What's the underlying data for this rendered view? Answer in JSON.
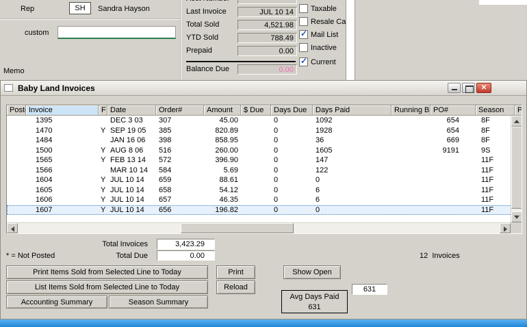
{
  "form": {
    "rep": {
      "label": "Rep",
      "code": "SH",
      "name": "Sandra Hayson"
    },
    "custom": {
      "label": "custom",
      "value": ""
    },
    "memo_label": "Memo",
    "balance_due_color": "#ee6fae",
    "fields": [
      {
        "label": "Acct Number",
        "value": "",
        "pink": false
      },
      {
        "label": "Last Invoice",
        "value": "JUL 10 14",
        "pink": false
      },
      {
        "label": "Total Sold",
        "value": "4,521.98",
        "pink": false
      },
      {
        "label": "YTD Sold",
        "value": "788.49",
        "pink": false
      },
      {
        "label": "Prepaid",
        "value": "0.00",
        "pink": false
      },
      {
        "label": "Balance Due",
        "value": "0.00",
        "pink": true
      }
    ],
    "checkboxes": [
      {
        "label": "Taxable",
        "checked": false
      },
      {
        "label": "Resale Card",
        "checked": false
      },
      {
        "label": "Mail List",
        "checked": true
      },
      {
        "label": "Inactive",
        "checked": false
      },
      {
        "label": "Current",
        "checked": true
      }
    ]
  },
  "invoices_window": {
    "title": "Baby Land Invoices",
    "columns": [
      "Posted",
      "Invoice",
      "F",
      "Date",
      "Order#",
      "Amount",
      "$ Due",
      "Days Due",
      "Days Paid",
      "Running Bal",
      "PO#",
      "Season",
      "Pic"
    ],
    "rows": [
      {
        "posted": "",
        "invoice": "1395",
        "f": "",
        "date": "DEC 3 03",
        "order": "307",
        "amount": "45.00",
        "due": "",
        "days_due": "0",
        "days_paid": "1092",
        "run_bal": "",
        "po": "654",
        "season": "8F",
        "pic": "",
        "selected": false
      },
      {
        "posted": "",
        "invoice": "1470",
        "f": "Y",
        "date": "SEP 19 05",
        "order": "385",
        "amount": "820.89",
        "due": "",
        "days_due": "0",
        "days_paid": "1928",
        "run_bal": "",
        "po": "654",
        "season": "8F",
        "pic": "",
        "selected": false
      },
      {
        "posted": "",
        "invoice": "1484",
        "f": "",
        "date": "JAN 16 06",
        "order": "398",
        "amount": "858.95",
        "due": "",
        "days_due": "0",
        "days_paid": "36",
        "run_bal": "",
        "po": "669",
        "season": "8F",
        "pic": "",
        "selected": false
      },
      {
        "posted": "",
        "invoice": "1500",
        "f": "Y",
        "date": "AUG 8 06",
        "order": "516",
        "amount": "260.00",
        "due": "",
        "days_due": "0",
        "days_paid": "1605",
        "run_bal": "",
        "po": "9191",
        "season": "9S",
        "pic": "",
        "selected": false
      },
      {
        "posted": "",
        "invoice": "1565",
        "f": "Y",
        "date": "FEB 13 14",
        "order": "572",
        "amount": "396.90",
        "due": "",
        "days_due": "0",
        "days_paid": "147",
        "run_bal": "",
        "po": "",
        "season": "11F",
        "pic": "",
        "selected": false
      },
      {
        "posted": "",
        "invoice": "1566",
        "f": "",
        "date": "MAR 10 14",
        "order": "584",
        "amount": "5.69",
        "due": "",
        "days_due": "0",
        "days_paid": "122",
        "run_bal": "",
        "po": "",
        "season": "11F",
        "pic": "",
        "selected": false
      },
      {
        "posted": "",
        "invoice": "1604",
        "f": "Y",
        "date": "JUL 10 14",
        "order": "659",
        "amount": "88.61",
        "due": "",
        "days_due": "0",
        "days_paid": "0",
        "run_bal": "",
        "po": "",
        "season": "11F",
        "pic": "",
        "selected": false
      },
      {
        "posted": "",
        "invoice": "1605",
        "f": "Y",
        "date": "JUL 10 14",
        "order": "658",
        "amount": "54.12",
        "due": "",
        "days_due": "0",
        "days_paid": "6",
        "run_bal": "",
        "po": "",
        "season": "11F",
        "pic": "",
        "selected": false
      },
      {
        "posted": "",
        "invoice": "1606",
        "f": "Y",
        "date": "JUL 10 14",
        "order": "657",
        "amount": "46.35",
        "due": "",
        "days_due": "0",
        "days_paid": "6",
        "run_bal": "",
        "po": "",
        "season": "11F",
        "pic": "",
        "selected": false
      },
      {
        "posted": "",
        "invoice": "1607",
        "f": "Y",
        "date": "JUL 10 14",
        "order": "656",
        "amount": "196.82",
        "due": "",
        "days_due": "0",
        "days_paid": "0",
        "run_bal": "",
        "po": "",
        "season": "11F",
        "pic": "",
        "selected": true
      }
    ],
    "summary": {
      "total_invoices_label": "Total Invoices",
      "total_invoices_value": "3,423.29",
      "total_due_label": "Total Due",
      "total_due_value": "0.00",
      "not_posted_note": "* = Not Posted",
      "invoice_count": "12  Invoices",
      "shown_value": "631",
      "avg_days_paid_label": "Avg Days Paid",
      "avg_days_paid_value": "631"
    },
    "buttons": {
      "print_items": "Print Items Sold from Selected Line to Today",
      "list_items": "List Items Sold from Selected Line to Today",
      "accounting_summary": "Accounting Summary",
      "season_summary": "Season Summary",
      "print": "Print",
      "reload": "Reload",
      "show_open": "Show Open"
    }
  }
}
